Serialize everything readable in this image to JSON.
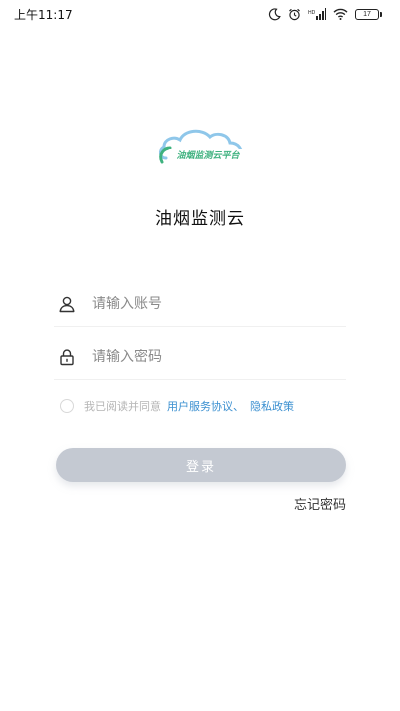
{
  "status_bar": {
    "time": "上午11:17",
    "battery": "17"
  },
  "logo": {
    "text": "油烟监测云平台"
  },
  "app_title": "油烟监测云",
  "account_field": {
    "placeholder": "请输入账号",
    "value": ""
  },
  "password_field": {
    "placeholder": "请输入密码",
    "value": ""
  },
  "agreement": {
    "prefix": "我已阅读并同意",
    "user_agreement": "用户服务协议、",
    "privacy_policy": "隐私政策"
  },
  "login_button": "登录",
  "forgot_password": "忘记密码",
  "colors": {
    "link": "#3a8fd0",
    "button_disabled": "#c4c9d2",
    "logo_green": "#3fb27f",
    "logo_blue": "#3a8fd0"
  }
}
